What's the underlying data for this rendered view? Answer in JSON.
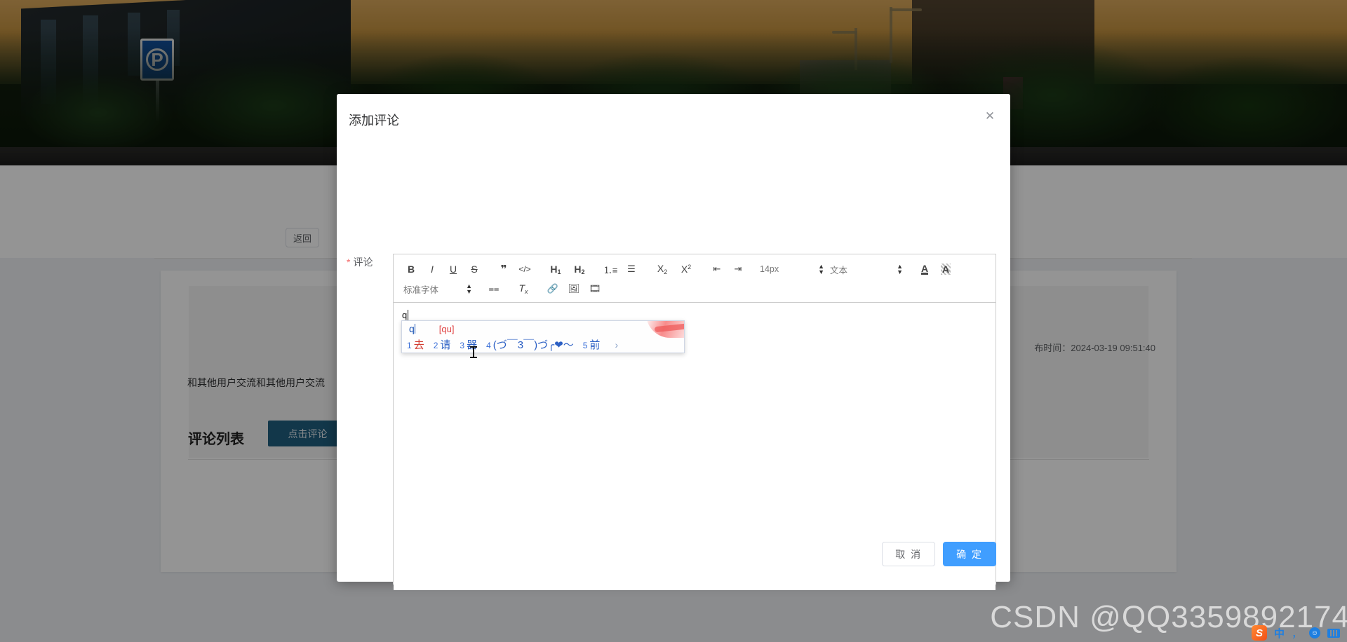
{
  "background_page": {
    "back_button": "返回",
    "publish_time": "布时间：2024-03-19 09:51:40",
    "post_body": "和其他用户交流和其他用户交流",
    "comment_list_title": "评论列表",
    "comment_button": "点击评论"
  },
  "modal": {
    "title": "添加评论",
    "close_icon": "close-icon",
    "field_label": "评论",
    "required_mark": "*",
    "cancel_label": "取 消",
    "confirm_label": "确 定",
    "confirm_color": "#409eff"
  },
  "editor": {
    "toolbar_row1": [
      {
        "name": "bold",
        "glyph": "B"
      },
      {
        "name": "italic",
        "glyph": "I"
      },
      {
        "name": "underline",
        "glyph": "U"
      },
      {
        "name": "strike",
        "glyph": "S"
      },
      {
        "name": "blockquote",
        "glyph": "❞"
      },
      {
        "name": "code-block",
        "glyph": "‹/›"
      },
      {
        "name": "heading-1",
        "glyph": "H1"
      },
      {
        "name": "heading-2",
        "glyph": "H2"
      },
      {
        "name": "ordered-list",
        "glyph": "≔"
      },
      {
        "name": "bullet-list",
        "glyph": "≡"
      },
      {
        "name": "subscript",
        "glyph": "X2"
      },
      {
        "name": "superscript",
        "glyph": "X2"
      },
      {
        "name": "outdent",
        "glyph": "⇤"
      },
      {
        "name": "indent",
        "glyph": "⇥"
      }
    ],
    "font_size_value": "14px",
    "text_style_value": "文本",
    "font_family_value": "标准字体",
    "toolbar_row1_end": [
      {
        "name": "font-color",
        "glyph": "A"
      },
      {
        "name": "background-color",
        "glyph": "A"
      }
    ],
    "toolbar_row2": [
      {
        "name": "align",
        "glyph": "≡"
      },
      {
        "name": "clear-format",
        "glyph": "Tx"
      },
      {
        "name": "link",
        "glyph": "🔗"
      },
      {
        "name": "image",
        "glyph": "▣"
      },
      {
        "name": "video",
        "glyph": "▤"
      }
    ],
    "typed_text": "q"
  },
  "ime": {
    "typed": "q",
    "pinyin": "[qu]",
    "candidates": [
      {
        "num": "1",
        "word": "去"
      },
      {
        "num": "2",
        "word": "请"
      },
      {
        "num": "3",
        "word": "器"
      },
      {
        "num": "4",
        "word": "(づ￣3￣)づ╭❤～"
      },
      {
        "num": "5",
        "word": "前"
      }
    ],
    "next_page_icon": "›"
  },
  "watermark": {
    "text": "CSDN @QQ3359892174"
  },
  "ime_status_bar": {
    "logo": "S",
    "mode": "中",
    "punctuation": "，",
    "emoji": "☺",
    "keyboard": "keyboard-icon"
  }
}
